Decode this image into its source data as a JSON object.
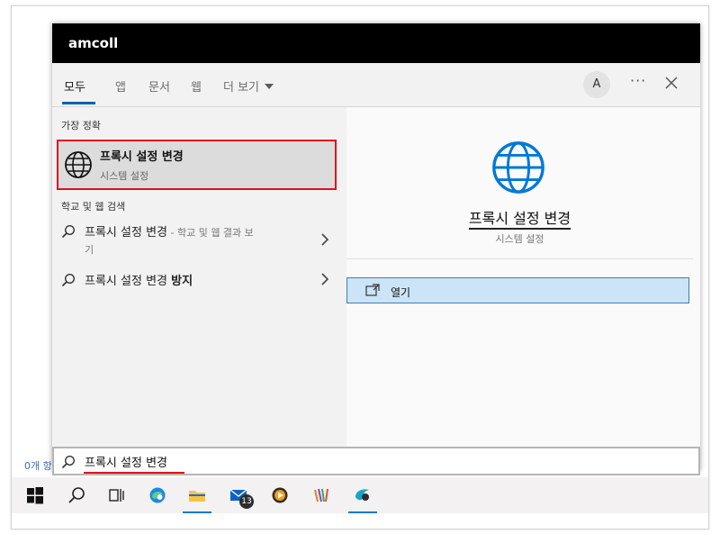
{
  "window": {
    "title": "amcoll"
  },
  "tabs": [
    {
      "label": "모두"
    },
    {
      "label": "앱"
    },
    {
      "label": "문서"
    },
    {
      "label": "웹"
    },
    {
      "label": "더 보기"
    }
  ],
  "header": {
    "avatar_initial": "A",
    "more_label": "···"
  },
  "left": {
    "best_match_heading": "가장 정확",
    "best_match": {
      "title": "프록시 설정 변경",
      "subtitle": "시스템 설정"
    },
    "web_heading": "학교 및 웹 검색",
    "web_results": [
      {
        "query": "프록시 설정 변경",
        "suffix": " - 학교 및 웹 결과 보",
        "line2": "기"
      },
      {
        "query": "프록시 설정 변경",
        "bold_suffix": "방지"
      }
    ]
  },
  "right": {
    "title": "프록시 설정 변경",
    "subtitle": "시스템 설정",
    "open_label": "열기"
  },
  "search": {
    "value": "프록시 설정 변경"
  },
  "background": {
    "status_text": "0개 항"
  },
  "taskbar": {
    "mail_badge": "13",
    "items": [
      "start-icon",
      "search-icon",
      "task-view-icon",
      "edge-icon",
      "file-explorer-icon",
      "mail-icon",
      "media-player-icon",
      "app-icon",
      "app-icon-2"
    ]
  },
  "colors": {
    "accent": "#0063b1",
    "highlight": "#e0121b",
    "selection": "#cce4f7"
  }
}
